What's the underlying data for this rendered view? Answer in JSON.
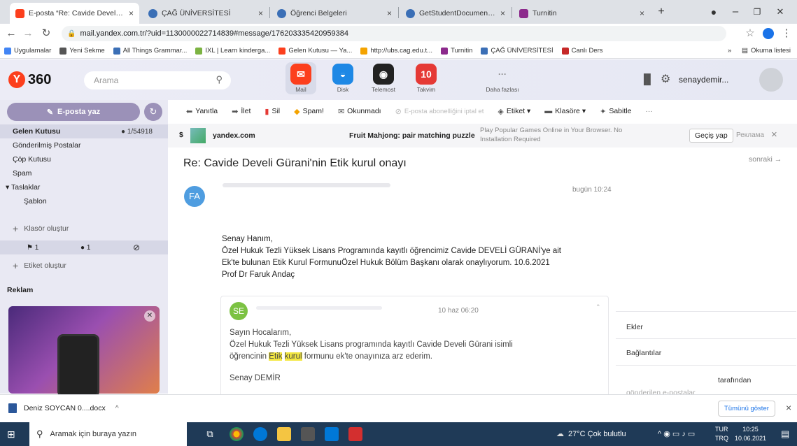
{
  "browser": {
    "tabs": [
      {
        "title": "E-posta “Re: Cavide Develi Gü",
        "close": "×",
        "fav_color": "#fc3f1d"
      },
      {
        "title": "ÇAĞ ÜNİVERSİTESİ",
        "close": "×",
        "fav_color": "#3b6fb6"
      },
      {
        "title": "Öğrenci Belgeleri",
        "close": "×",
        "fav_color": "#3b6fb6"
      },
      {
        "title": "GetStudentDocumentReports",
        "close": "×",
        "fav_color": "#3b6fb6"
      },
      {
        "title": "Turnitin",
        "close": "×",
        "fav_color": "#8c2a8c"
      }
    ],
    "new_tab": "+",
    "window": {
      "minimize": "–",
      "maximize": "❐",
      "close": "✕"
    },
    "url": "mail.yandex.com.tr/?uid=1130000022714839#message/176203335420959384",
    "bookmarks": [
      {
        "label": "Uygulamalar",
        "color": "#4285f4"
      },
      {
        "label": "Yeni Sekme",
        "color": "#555555"
      },
      {
        "label": "All Things Grammar...",
        "color": "#3b6fb6"
      },
      {
        "label": "IXL | Learn kinderga...",
        "color": "#7cb342"
      },
      {
        "label": "Gelen Kutusu — Ya...",
        "color": "#fc3f1d"
      },
      {
        "label": "http://ubs.cag.edu.t...",
        "color": "#f4a300"
      },
      {
        "label": "Turnitin",
        "color": "#8c2a8c"
      },
      {
        "label": "ÇAĞ ÜNİVERSİTESİ",
        "color": "#3b6fb6"
      },
      {
        "label": "Canlı Ders",
        "color": "#c62828"
      }
    ],
    "bookmark_more": "»",
    "reading_list": "Okuma listesi"
  },
  "mail_header": {
    "logo_letter": "Y",
    "logo_text": "360",
    "search_placeholder": "Arama",
    "apps": [
      {
        "label": "Mail",
        "color": "#fc3f1d",
        "glyph": "✉"
      },
      {
        "label": "Disk",
        "color": "#1e88e5",
        "glyph": "◒"
      },
      {
        "label": "Telemost",
        "color": "#222222",
        "glyph": "◉"
      },
      {
        "label": "Takvim",
        "color": "#e53935",
        "glyph": "10"
      },
      {
        "label": "Daha fazlası",
        "color": "transparent",
        "glyph": "···"
      }
    ],
    "username": "senaydemir..."
  },
  "sidebar": {
    "compose": "E-posta yaz",
    "folders": [
      {
        "label": "Gelen Kutusu",
        "count": "1/54918",
        "active": true
      },
      {
        "label": "Gönderilmiş Postalar",
        "count": ""
      },
      {
        "label": "Çöp Kutusu",
        "count": ""
      },
      {
        "label": "Spam",
        "count": ""
      },
      {
        "label": "▾ Taslaklar",
        "count": ""
      },
      {
        "label": "Şablon",
        "count": ""
      }
    ],
    "create_folder": "Klasör oluştur",
    "label_counts": [
      "1",
      "1"
    ],
    "create_label": "Etiket oluştur",
    "ads_title": "Reklam"
  },
  "toolbar": {
    "items": [
      {
        "label": "Yanıtla",
        "icon": "reply-icon",
        "glyph": "⬅"
      },
      {
        "label": "İlet",
        "icon": "forward-icon",
        "glyph": "➡"
      },
      {
        "label": "Sil",
        "icon": "trash-icon",
        "glyph": "🗑"
      },
      {
        "label": "Spam!",
        "icon": "spam-icon",
        "glyph": "⚠"
      },
      {
        "label": "Okunmadı",
        "icon": "envelope-icon",
        "glyph": "✉"
      },
      {
        "label": "E-posta abonelliğini iptal et",
        "icon": "unsubscribe-icon",
        "glyph": "⊘"
      },
      {
        "label": "Etiket ▾",
        "icon": "tag-icon",
        "glyph": "🏷"
      },
      {
        "label": "Klasöre ▾",
        "icon": "folder-icon",
        "glyph": "▬"
      },
      {
        "label": "Sabitle",
        "icon": "pin-icon",
        "glyph": "📌"
      },
      {
        "label": "···",
        "icon": "more-icon",
        "glyph": ""
      }
    ]
  },
  "ad": {
    "dollar": "$",
    "domain": "yandex.com",
    "title": "Fruit Mahjong: pair matching puzzle",
    "desc": "Play Popular Games Online in Your Browser. No Installation Required",
    "cta": "Geçiş yap",
    "label": "Реклама",
    "close": "×"
  },
  "message": {
    "subject": "Re: Cavide Develi Gürani'nin Etik kurul onayı",
    "next": "sonraki →",
    "sender_initials": "FA",
    "sender_color": "#4f9de0",
    "date": "bugün 10:24",
    "body": [
      "Senay Hanım,",
      "Özel Hukuk Tezli Yüksek Lisans Programında kayıtlı öğrencimiz Cavide DEVELİ GÜRANİ'ye ait",
      "Ek'te bulunan Etik Kurul FormunuÖzel Hukuk Bölüm Başkanı olarak onaylıyorum. 10.6.2021",
      "Prof Dr Faruk Andaç"
    ],
    "quoted": {
      "initials": "SE",
      "color": "#7cc243",
      "date": "10 haz 06:20",
      "line1": "Sayın Hocalarım,",
      "line2": "Özel Hukuk Tezli Yüksek Lisans programında kayıtlı Cavide Develi Gürani isimli",
      "line3_pre": "öğrencinin",
      "hl1": "Etik",
      "hl2": "kurul",
      "line3_post": "formunu ek'te onayınıza arz ederim.",
      "sig": "Senay DEMİR"
    }
  },
  "right_panel": {
    "attachments": "Ekler",
    "links": "Bağlantılar",
    "by": "tarafından",
    "sent": "gönderilen e-postalar"
  },
  "downloads": {
    "file": "Deniz SOYCAN 0....docx",
    "chevron": "^",
    "show_all": "Tümünü göster",
    "close": "×"
  },
  "taskbar": {
    "search_placeholder": "Aramak için buraya yazın",
    "weather": "27°C  Çok bulutlu",
    "lang1": "TUR",
    "lang2": "TRQ",
    "time": "10:25",
    "date": "10.06.2021"
  }
}
